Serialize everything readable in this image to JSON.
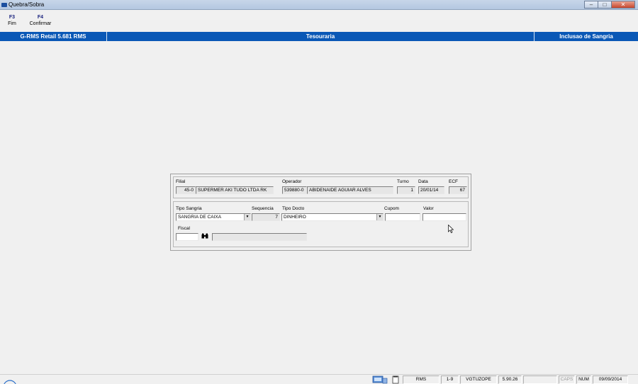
{
  "window": {
    "title": "Quebra/Sobra",
    "min": "–",
    "max": "□",
    "close": "✕"
  },
  "toolbar": {
    "items": [
      {
        "key": "F3",
        "label": "Fim"
      },
      {
        "key": "F4",
        "label": "Confirmar"
      }
    ]
  },
  "header": {
    "left": "G-RMS Retail 5.681 RMS",
    "center": "Tesouraria",
    "right": "Inclusao de Sangria"
  },
  "form": {
    "filial": {
      "label": "Filial",
      "code": "45-0",
      "name": "SUPERMER AKI TUDO LTDA RK"
    },
    "operador": {
      "label": "Operador",
      "code": "539880-0",
      "name": "ABIDENAIDE AGUIAR ALVES"
    },
    "turno": {
      "label": "Turno",
      "value": "1"
    },
    "data": {
      "label": "Data",
      "value": "20/01/14"
    },
    "ecf": {
      "label": "ECF",
      "value": "67"
    },
    "tipo_sangria": {
      "label": "Tipo Sangria",
      "value": "SANGRIA DE CAIXA"
    },
    "sequencia": {
      "label": "Sequencia",
      "value": "7"
    },
    "tipo_docto": {
      "label": "Tipo Docto",
      "value": "DINHEIRO"
    },
    "cupom": {
      "label": "Cupom",
      "value": ""
    },
    "valor": {
      "label": "Valor",
      "value": ""
    },
    "fiscal": {
      "label": "Fiscal",
      "value": "",
      "description": ""
    }
  },
  "statusbar": {
    "system": "RMS",
    "range": "1-9",
    "user": "VGTUZOPE",
    "version": "5.90.26",
    "blank": "",
    "caps": "CAPS",
    "num": "NUM",
    "date": "09/09/2014"
  },
  "colors": {
    "header_bg": "#0a58b6",
    "key_text": "#1a237e"
  }
}
